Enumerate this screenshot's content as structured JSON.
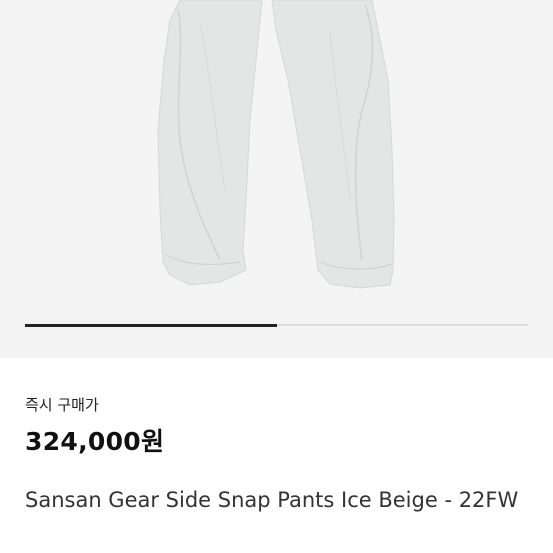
{
  "product": {
    "image_alt": "Sansan Gear Side Snap Pants Ice Beige",
    "carousel_progress": 0.5,
    "price_label": "즉시 구매가",
    "price": "324,000원",
    "title": "Sansan Gear Side Snap Pants Ice Beige - 22FW"
  },
  "colors": {
    "image_background": "#f4f4f4",
    "pants_fill": "#e3e6e5",
    "indicator_active": "#222222",
    "indicator_track": "#dcdcdc"
  }
}
